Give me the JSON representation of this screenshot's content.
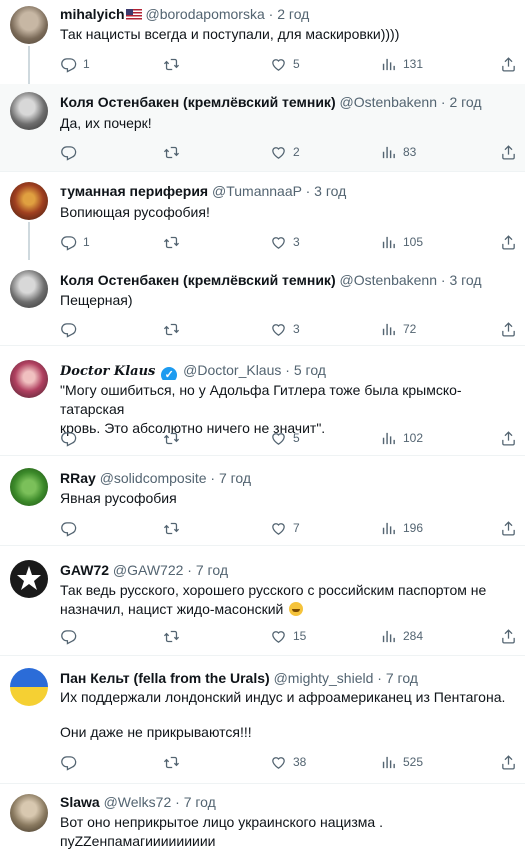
{
  "tweets": [
    {
      "name": "mihalyich",
      "handle": "@borodapomorska",
      "time": "2 год",
      "text": "Так нацисты всегда и поступали, для маскировки))))",
      "reply": "1",
      "rt": "",
      "like": "5",
      "views": "131"
    },
    {
      "name": "Коля Остенбакен (кремлёвский темник)",
      "handle": "@Ostenbakenn",
      "time": "2 год",
      "text": "Да, их почерк!",
      "reply": "",
      "rt": "",
      "like": "2",
      "views": "83"
    },
    {
      "name": "туманная периферия",
      "handle": "@TumannaaP",
      "time": "3 год",
      "text": "Вопиющая русофобия!",
      "reply": "1",
      "rt": "",
      "like": "3",
      "views": "105"
    },
    {
      "name": "Коля Остенбакен (кремлёвский темник)",
      "handle": "@Ostenbakenn",
      "time": "3 год",
      "text": "Пещерная)",
      "reply": "",
      "rt": "",
      "like": "3",
      "views": "72"
    },
    {
      "name": "Doctor Klaus",
      "handle": "@Doctor_Klaus",
      "time": "5 год",
      "text_line1": "\"Могу ошибиться, но у Адольфа Гитлера тоже была крымско-татарская",
      "text_line2": "кровь. Это абсолютно ничего не значит\".",
      "reply": "",
      "rt": "",
      "like": "5",
      "views": "102"
    },
    {
      "name": "RRay",
      "handle": "@solidcomposite",
      "time": "7 год",
      "text": "Явная русофобия",
      "reply": "",
      "rt": "",
      "like": "7",
      "views": "196"
    },
    {
      "name": "GAW72",
      "handle": "@GAW722",
      "time": "7 год",
      "text_line1": "Так ведь русского, хорошего русского с российским паспортом не",
      "text_line2": "назначил, нацист жидо-масонский",
      "reply": "",
      "rt": "",
      "like": "15",
      "views": "284"
    },
    {
      "name": "Пан Кельт (fella from the Urals)",
      "handle": "@mighty_shield",
      "time": "7 год",
      "text_line1": "Их поддержали лондонский индус и афроамериканец из Пентагона.",
      "text_line2": "Они даже не прикрываются!!!",
      "reply": "",
      "rt": "",
      "like": "38",
      "views": "525"
    },
    {
      "name": "Slawa",
      "handle": "@Welks72",
      "time": "7 год",
      "text_line1": "Вот оно неприкрытое лицо украинского нацизма .",
      "text_line2": "пуZZенпамагиииииииии"
    }
  ],
  "separator": "·",
  "verified_mark": "✓",
  "colors": {
    "accent": "#1d9bf0",
    "muted": "#536471",
    "border": "#eff3f4",
    "thread": "#cfd9de",
    "highlight": "#f7f9f9"
  }
}
